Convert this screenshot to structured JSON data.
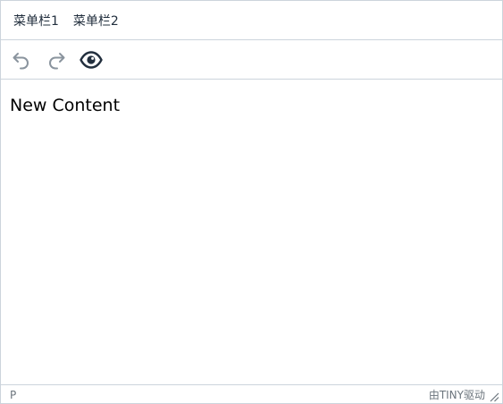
{
  "menubar": {
    "items": [
      {
        "label": "菜单栏1"
      },
      {
        "label": "菜单栏2"
      }
    ]
  },
  "toolbar": {
    "buttons": [
      {
        "icon": "undo-icon",
        "color": "#8a949e"
      },
      {
        "icon": "redo-icon",
        "color": "#8a949e"
      },
      {
        "icon": "eye-icon",
        "color": "#222f3e"
      }
    ]
  },
  "content": {
    "paragraph": "New Content"
  },
  "statusbar": {
    "path": "P",
    "branding": "由TINY驱动"
  }
}
